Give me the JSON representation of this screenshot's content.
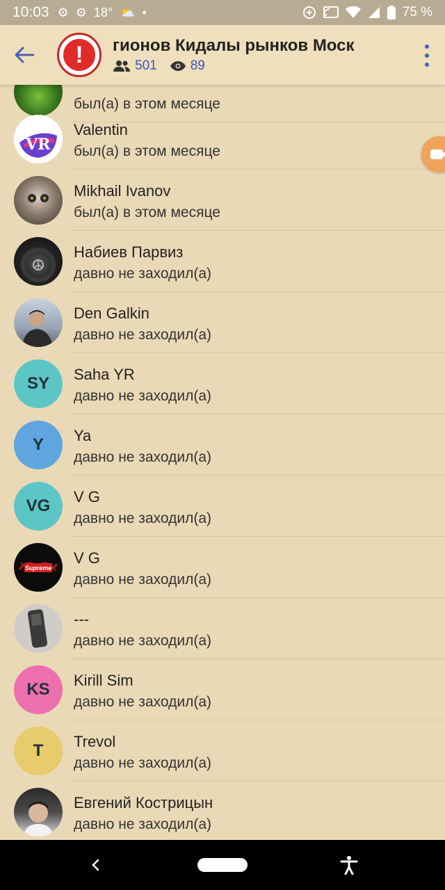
{
  "status_bar": {
    "time": "10:03",
    "temperature": "18°",
    "battery": "75 %"
  },
  "header": {
    "title": "гионов   Кидалы рынков Моск",
    "members_count": "501",
    "online_count": "89",
    "avatar_glyph": "!"
  },
  "members": [
    {
      "name": "",
      "status": "был(а) в этом месяце",
      "avatar_type": "image",
      "avatar_color": "#4a8a2a"
    },
    {
      "name": "Valentin",
      "status": "был(а) в этом месяце",
      "avatar_type": "image",
      "avatar_color": "#3a4fb0"
    },
    {
      "name": "Mikhail Ivanov",
      "status": "был(а) в этом месяце",
      "avatar_type": "image",
      "avatar_color": "#6b6258"
    },
    {
      "name": "Набиев Парвиз",
      "status": "давно не заходил(а)",
      "avatar_type": "image",
      "avatar_color": "#1c1c1c"
    },
    {
      "name": "Den Galkin",
      "status": "давно не заходил(а)",
      "avatar_type": "image",
      "avatar_color": "#7d8ca0"
    },
    {
      "name": "Saha YR",
      "status": "давно не заходил(а)",
      "avatar_type": "initials",
      "initials": "SY",
      "avatar_color": "#5cc6c6"
    },
    {
      "name": "Ya",
      "status": "давно не заходил(а)",
      "avatar_type": "initials",
      "initials": "Y",
      "avatar_color": "#5fa6e0"
    },
    {
      "name": "V G",
      "status": "давно не заходил(а)",
      "avatar_type": "initials",
      "initials": "VG",
      "avatar_color": "#5cc6c6"
    },
    {
      "name": "V G",
      "status": "давно не заходил(а)",
      "avatar_type": "image",
      "avatar_color": "#111111"
    },
    {
      "name": "---",
      "status": "давно не заходил(а)",
      "avatar_type": "image",
      "avatar_color": "#c9c6c2"
    },
    {
      "name": "Kirill Sim",
      "status": "давно не заходил(а)",
      "avatar_type": "initials",
      "initials": "KS",
      "avatar_color": "#ee6fad"
    },
    {
      "name": "Trevol",
      "status": "давно не заходил(а)",
      "avatar_type": "initials",
      "initials": "T",
      "avatar_color": "#e8cb6a"
    },
    {
      "name": "Евгений Кострицын",
      "status": "давно не заходил(а)",
      "avatar_type": "image",
      "avatar_color": "#3a3a3a"
    }
  ],
  "colors": {
    "background": "#ead9b6",
    "header": "#efdfbd",
    "accent": "#3d55b8",
    "float_button": "#f0a35b"
  },
  "icons": {
    "back": "arrow-left-icon",
    "members": "people-icon",
    "views": "eye-icon",
    "menu": "more-vert-icon",
    "float": "video-camera-icon"
  }
}
